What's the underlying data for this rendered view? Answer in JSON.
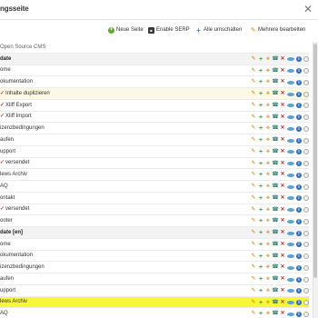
{
  "window": {
    "title": "ngsseite",
    "close_symbol": "✕"
  },
  "toolbar": {
    "new_page": "Neue Seite",
    "enable_serp": "Enable SERP",
    "toggle_all": "Alle umschalten",
    "edit_multiple": "Mehrere bearbeiten"
  },
  "icons": {
    "new": "+",
    "serp": "■",
    "toggle": "+",
    "edit": "✎",
    "row_edit": "✎",
    "row_add": "+",
    "row_move": "✥",
    "row_phone": "☎",
    "row_del": "✕",
    "row_info": "i",
    "tick": "✓"
  },
  "tree": [
    {
      "label": "Open Source CMS",
      "type": "section"
    },
    {
      "label": "date",
      "type": "header"
    },
    {
      "label": "ome",
      "type": "item"
    },
    {
      "label": "okumentation",
      "type": "item"
    },
    {
      "label": "Inhalte duplizieren",
      "type": "yellow",
      "tick": true
    },
    {
      "label": "Xliff Export",
      "type": "item",
      "tick": true
    },
    {
      "label": "Xliff Import",
      "type": "item",
      "tick": true
    },
    {
      "label": "izenzbedingungen",
      "type": "item"
    },
    {
      "label": "aufen",
      "type": "item"
    },
    {
      "label": "upport",
      "type": "item"
    },
    {
      "label": "versendet",
      "type": "item",
      "tick": true
    },
    {
      "label": "lews Archiv",
      "type": "item"
    },
    {
      "label": "AQ",
      "type": "item"
    },
    {
      "label": "ontakt",
      "type": "item"
    },
    {
      "label": "versendet",
      "type": "item",
      "tick": true
    },
    {
      "label": "ooter",
      "type": "item"
    },
    {
      "label": "date [en]",
      "type": "header"
    },
    {
      "label": "ome",
      "type": "item"
    },
    {
      "label": "okumentation",
      "type": "item"
    },
    {
      "label": "izenzbedingungen",
      "type": "item"
    },
    {
      "label": "aufen",
      "type": "item"
    },
    {
      "label": "upport",
      "type": "item"
    },
    {
      "label": "lews Archiv",
      "type": "highlight"
    },
    {
      "label": "AQ",
      "type": "item"
    }
  ]
}
